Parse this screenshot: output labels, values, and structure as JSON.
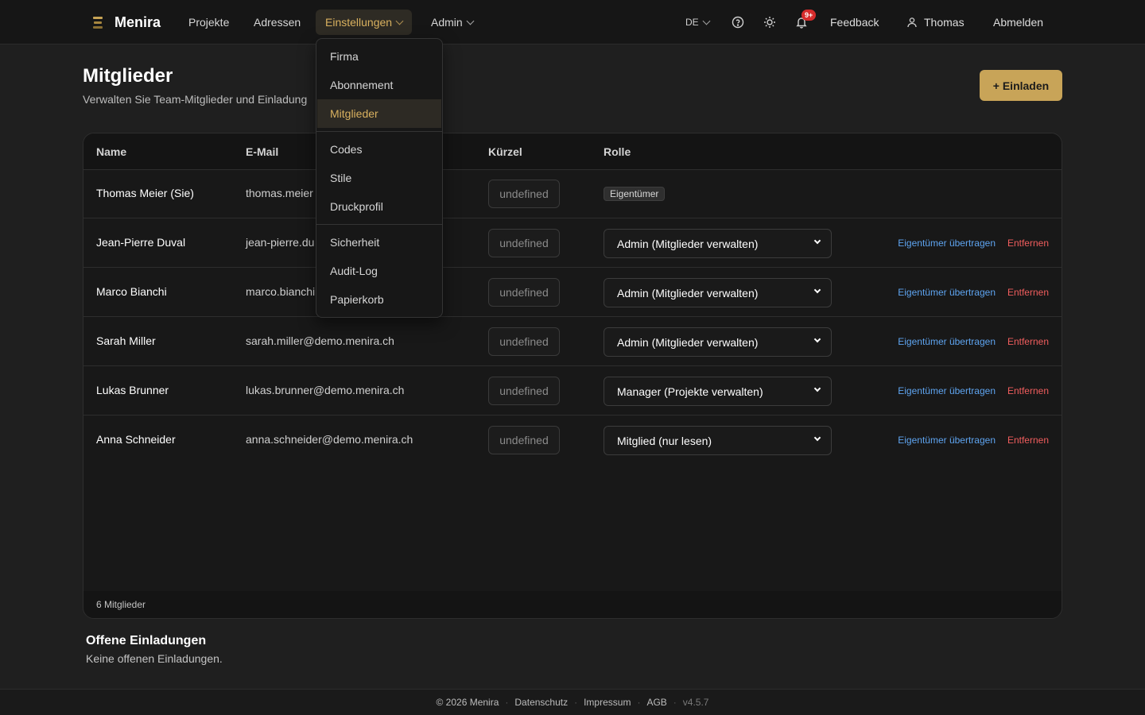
{
  "brand": {
    "name": "Menira"
  },
  "nav": {
    "projects": "Projekte",
    "addresses": "Adressen",
    "settings": "Einstellungen",
    "admin": "Admin",
    "language": "DE",
    "notifications_badge": "9+",
    "feedback": "Feedback",
    "user": "Thomas",
    "logout": "Abmelden"
  },
  "settings_menu": {
    "items": [
      "Firma",
      "Abonnement",
      "Mitglieder",
      "Codes",
      "Stile",
      "Druckprofil",
      "Sicherheit",
      "Audit-Log",
      "Papierkorb"
    ],
    "active": "Mitglieder"
  },
  "page": {
    "title": "Mitglieder",
    "subtitle": "Verwalten Sie Team-Mitglieder und Einladung",
    "invite_button": "+ Einladen"
  },
  "table": {
    "headers": {
      "name": "Name",
      "email": "E-Mail",
      "kuerzel": "Kürzel",
      "role": "Rolle"
    },
    "rows": [
      {
        "name": "Thomas Meier (Sie)",
        "email": "thomas.meier",
        "kuerzel": "undefined",
        "role": "Eigentümer",
        "is_owner": true
      },
      {
        "name": "Jean-Pierre Duval",
        "email": "jean-pierre.du",
        "kuerzel": "undefined",
        "role": "Admin (Mitglieder verwalten)",
        "transfer": "Eigentümer übertragen",
        "remove": "Entfernen"
      },
      {
        "name": "Marco Bianchi",
        "email": "marco.bianchi",
        "kuerzel": "undefined",
        "role": "Admin (Mitglieder verwalten)",
        "transfer": "Eigentümer übertragen",
        "remove": "Entfernen"
      },
      {
        "name": "Sarah Miller",
        "email": "sarah.miller@demo.menira.ch",
        "kuerzel": "undefined",
        "role": "Admin (Mitglieder verwalten)",
        "transfer": "Eigentümer übertragen",
        "remove": "Entfernen"
      },
      {
        "name": "Lukas Brunner",
        "email": "lukas.brunner@demo.menira.ch",
        "kuerzel": "undefined",
        "role": "Manager (Projekte verwalten)",
        "transfer": "Eigentümer übertragen",
        "remove": "Entfernen"
      },
      {
        "name": "Anna Schneider",
        "email": "anna.schneider@demo.menira.ch",
        "kuerzel": "undefined",
        "role": "Mitglied (nur lesen)",
        "transfer": "Eigentümer übertragen",
        "remove": "Entfernen"
      }
    ],
    "count": "6 Mitglieder"
  },
  "invites": {
    "title": "Offene Einladungen",
    "empty": "Keine offenen Einladungen."
  },
  "footer": {
    "copyright": "© 2026 Menira",
    "privacy": "Datenschutz",
    "imprint": "Impressum",
    "terms": "AGB",
    "version": "v4.5.7"
  },
  "colors": {
    "accent": "#c8a458",
    "link_blue": "#5ea4f0",
    "danger_red": "#f05d5d",
    "badge_red": "#d62c2c"
  },
  "icons": {
    "help": "help-circle-icon",
    "theme": "sun-icon",
    "notifications": "bell-icon",
    "user": "user-icon"
  }
}
